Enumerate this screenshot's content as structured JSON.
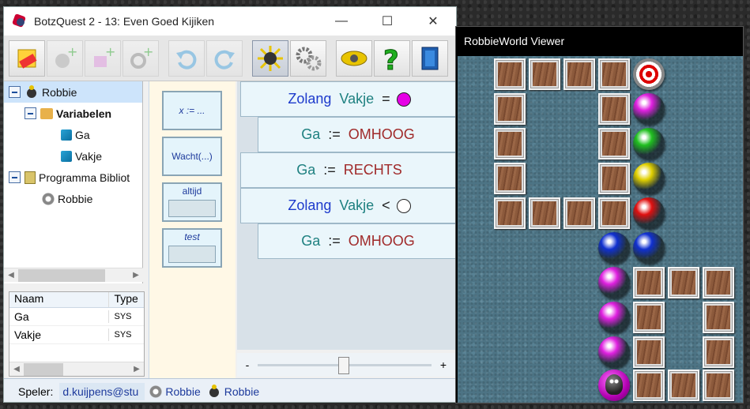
{
  "window": {
    "title": "BotzQuest 2 - 13: Even Goed Kijiken",
    "controls": {
      "minimize": "—",
      "maximize": "☐",
      "close": "✕"
    }
  },
  "toolbar": {
    "buttons": [
      {
        "name": "erase-icon",
        "enabled": true
      },
      {
        "name": "add-robot-icon",
        "enabled": false
      },
      {
        "name": "add-variable-icon",
        "enabled": false
      },
      {
        "name": "add-gear-icon",
        "enabled": false
      },
      {
        "name": "undo-icon",
        "enabled": false
      },
      {
        "name": "redo-icon",
        "enabled": false
      },
      {
        "name": "run-icon",
        "enabled": true
      },
      {
        "name": "gears-icon",
        "enabled": true
      },
      {
        "name": "badge-icon",
        "enabled": true
      },
      {
        "name": "help-icon",
        "enabled": true
      },
      {
        "name": "exit-icon",
        "enabled": true
      }
    ]
  },
  "tree": {
    "robbie": "Robbie",
    "variabelen": "Variabelen",
    "ga": "Ga",
    "vakje": "Vakje",
    "library": "Programma Bibliot",
    "library_robbie": "Robbie"
  },
  "vartable": {
    "headers": [
      "Naam",
      "Type"
    ],
    "rows": [
      {
        "naam": "Ga",
        "type": "SYS"
      },
      {
        "naam": "Vakje",
        "type": "SYS"
      }
    ]
  },
  "palette": {
    "assign": "x := ...",
    "wait": "Wacht(...)",
    "always": "altijd",
    "test": "test"
  },
  "program": [
    {
      "kw": "Zolang",
      "var": "Vakje",
      "op": "=",
      "color": "#e600e6"
    },
    {
      "var": "Ga",
      "op": ":=",
      "val": "OMHOOG"
    },
    {
      "var": "Ga",
      "op": ":=",
      "val": "RECHTS"
    },
    {
      "kw": "Zolang",
      "var": "Vakje",
      "op": "<",
      "color": "#ffffff"
    },
    {
      "var": "Ga",
      "op": ":=",
      "val": "OMHOOG"
    }
  ],
  "zoom": {
    "minus": "-",
    "plus": "+"
  },
  "status": {
    "speler_label": "Speler:",
    "speler_value": "d.kuijpens@stu",
    "robot1": "Robbie",
    "robot2": "Robbie"
  },
  "viewer": {
    "title": "RobbieWorld Viewer"
  },
  "world_colors": {
    "magenta": "#e020e0",
    "green": "#20c020",
    "yellow": "#e0d000",
    "red": "#e01010",
    "blue": "#1030d0"
  }
}
